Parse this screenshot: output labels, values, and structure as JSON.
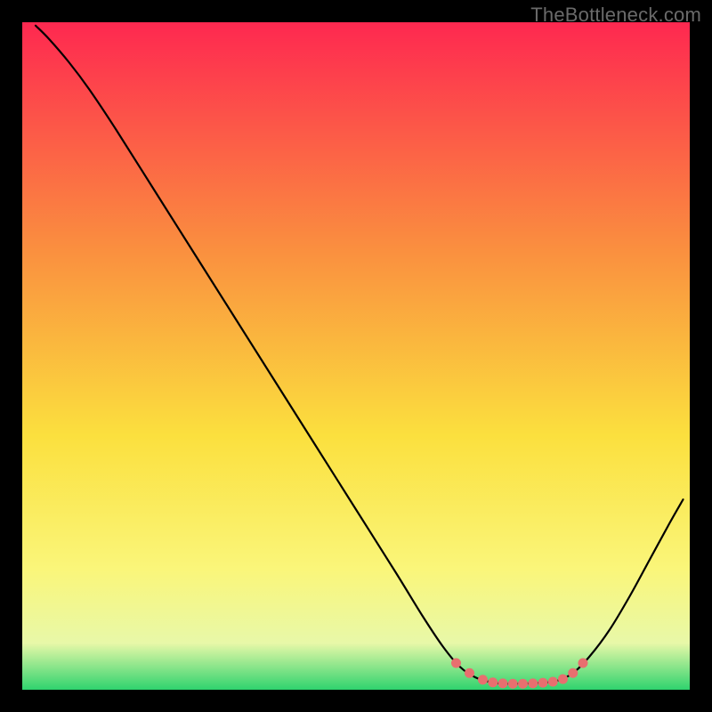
{
  "attribution": "TheBottleneck.com",
  "chart_data": {
    "type": "line",
    "title": "",
    "xlabel": "",
    "ylabel": "",
    "xlim": [
      0,
      100
    ],
    "ylim": [
      0,
      100
    ],
    "background_gradient": {
      "top": "#fe2850",
      "upper_mid": "#fa8f3f",
      "mid": "#fbe03e",
      "lower_mid": "#faf67a",
      "near_bottom": "#e8f8a8",
      "bottom": "#2fd36e"
    },
    "curve": [
      {
        "x": 2.0,
        "y": 99.5
      },
      {
        "x": 4.0,
        "y": 97.5
      },
      {
        "x": 7.0,
        "y": 94.0
      },
      {
        "x": 10.0,
        "y": 90.0
      },
      {
        "x": 14.0,
        "y": 84.0
      },
      {
        "x": 20.0,
        "y": 74.5
      },
      {
        "x": 26.0,
        "y": 65.0
      },
      {
        "x": 32.0,
        "y": 55.5
      },
      {
        "x": 38.0,
        "y": 46.0
      },
      {
        "x": 44.0,
        "y": 36.5
      },
      {
        "x": 50.0,
        "y": 27.0
      },
      {
        "x": 56.0,
        "y": 17.5
      },
      {
        "x": 60.0,
        "y": 11.0
      },
      {
        "x": 63.0,
        "y": 6.5
      },
      {
        "x": 65.5,
        "y": 3.5
      },
      {
        "x": 68.0,
        "y": 1.8
      },
      {
        "x": 71.0,
        "y": 1.0
      },
      {
        "x": 74.0,
        "y": 0.9
      },
      {
        "x": 77.0,
        "y": 1.0
      },
      {
        "x": 80.0,
        "y": 1.3
      },
      {
        "x": 82.5,
        "y": 2.5
      },
      {
        "x": 85.0,
        "y": 5.0
      },
      {
        "x": 88.0,
        "y": 9.0
      },
      {
        "x": 91.0,
        "y": 14.0
      },
      {
        "x": 94.0,
        "y": 19.5
      },
      {
        "x": 97.0,
        "y": 25.0
      },
      {
        "x": 99.0,
        "y": 28.5
      }
    ],
    "markers": [
      {
        "x": 65.0,
        "y": 4.0
      },
      {
        "x": 67.0,
        "y": 2.5
      },
      {
        "x": 69.0,
        "y": 1.5
      },
      {
        "x": 70.5,
        "y": 1.1
      },
      {
        "x": 72.0,
        "y": 0.95
      },
      {
        "x": 73.5,
        "y": 0.9
      },
      {
        "x": 75.0,
        "y": 0.9
      },
      {
        "x": 76.5,
        "y": 0.95
      },
      {
        "x": 78.0,
        "y": 1.05
      },
      {
        "x": 79.5,
        "y": 1.2
      },
      {
        "x": 81.0,
        "y": 1.6
      },
      {
        "x": 82.5,
        "y": 2.5
      },
      {
        "x": 84.0,
        "y": 4.0
      }
    ],
    "marker_color": "#e86f6f",
    "marker_radius": 5.5
  }
}
